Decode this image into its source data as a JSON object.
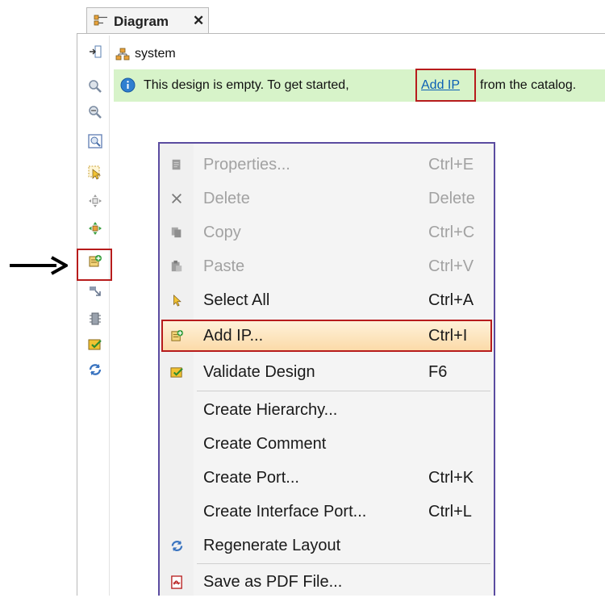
{
  "tab": {
    "title": "Diagram",
    "close": "✕"
  },
  "breadcrumb": {
    "label": "system"
  },
  "banner": {
    "text": "This design is empty. To get started,",
    "link": "Add IP",
    "tail": "from the catalog."
  },
  "menu": {
    "items": [
      {
        "label": "Properties...",
        "shortcut": "Ctrl+E",
        "enabled": false,
        "icon": "properties-icon"
      },
      {
        "label": "Delete",
        "shortcut": "Delete",
        "enabled": false,
        "icon": "delete-icon"
      },
      {
        "label": "Copy",
        "shortcut": "Ctrl+C",
        "enabled": false,
        "icon": "copy-icon"
      },
      {
        "label": "Paste",
        "shortcut": "Ctrl+V",
        "enabled": false,
        "icon": "paste-icon"
      },
      {
        "label": "Select All",
        "shortcut": "Ctrl+A",
        "enabled": true,
        "icon": "select-all-icon"
      },
      {
        "label": "Add IP...",
        "shortcut": "Ctrl+I",
        "enabled": true,
        "highlighted": true,
        "icon": "add-ip-icon"
      },
      {
        "label": "Validate Design",
        "shortcut": "F6",
        "enabled": true,
        "icon": "validate-icon"
      },
      {
        "label": "Create Hierarchy...",
        "shortcut": "",
        "enabled": true
      },
      {
        "label": "Create Comment",
        "shortcut": "",
        "enabled": true
      },
      {
        "label": "Create Port...",
        "shortcut": "Ctrl+K",
        "enabled": true
      },
      {
        "label": "Create Interface Port...",
        "shortcut": "Ctrl+L",
        "enabled": true
      },
      {
        "label": "Regenerate Layout",
        "shortcut": "",
        "enabled": true,
        "icon": "regenerate-icon"
      },
      {
        "label": "Save as PDF File...",
        "shortcut": "",
        "enabled": true,
        "icon": "pdf-icon"
      }
    ]
  },
  "toolbar": {
    "icons": [
      "fit-panel-icon",
      "zoom-in-icon",
      "zoom-out-icon",
      "zoom-fit-icon",
      "select-area-icon",
      "move-icon",
      "autoconnect-icon",
      "add-ip-icon",
      "make-external-icon",
      "run-automation-icon",
      "validate-icon",
      "regenerate-icon"
    ]
  },
  "colors": {
    "banner_bg": "#d7f3c9",
    "highlight_border": "#b71c1c",
    "menu_border": "#5b4ca0",
    "link": "#0b5fb5"
  }
}
